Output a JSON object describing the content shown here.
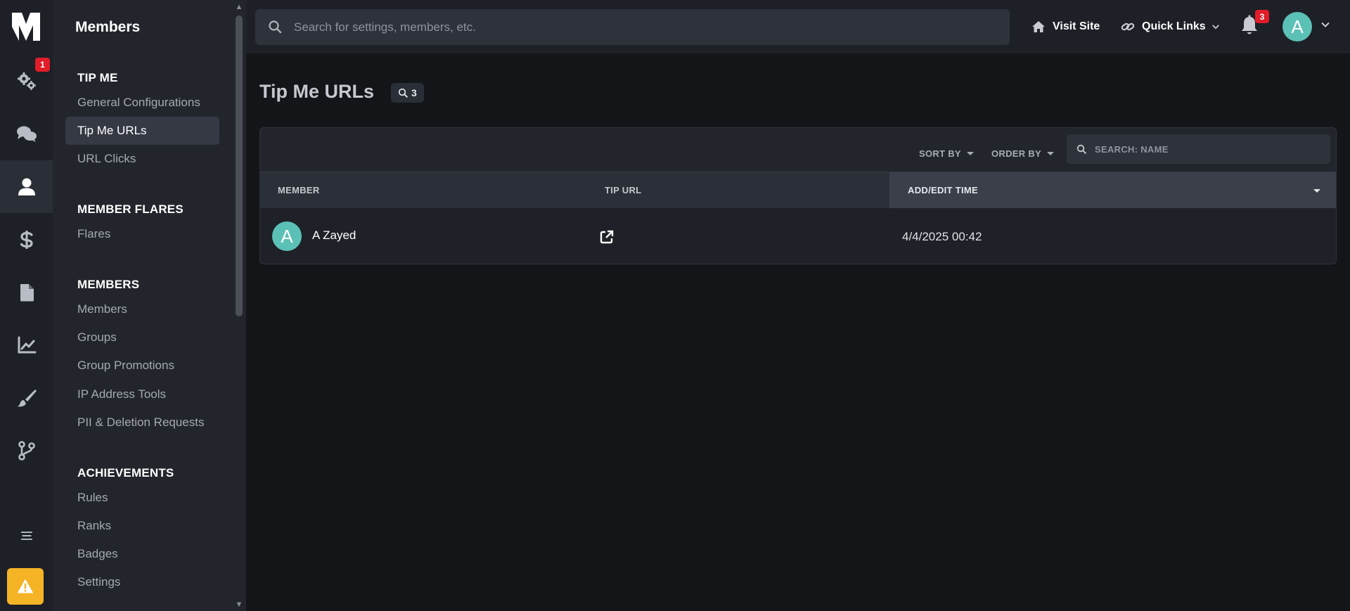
{
  "header": {
    "search_placeholder": "Search for settings, members, etc.",
    "visit_site": "Visit Site",
    "quick_links": "Quick Links",
    "notification_count": "3",
    "avatar_letter": "A"
  },
  "rail": {
    "settings_badge": "1",
    "items": [
      "gears-icon",
      "chat-icon",
      "user-icon",
      "dollar-icon",
      "file-icon",
      "chart-line-icon",
      "paintbrush-icon",
      "branch-icon",
      "menu-icon"
    ],
    "active": "user-icon"
  },
  "subnav": {
    "title": "Members",
    "sections": [
      {
        "label": "TIP ME",
        "links": [
          "General Configurations",
          "Tip Me URLs",
          "URL Clicks"
        ]
      },
      {
        "label": "MEMBER FLARES",
        "links": [
          "Flares"
        ]
      },
      {
        "label": "MEMBERS",
        "links": [
          "Members",
          "Groups",
          "Group Promotions",
          "IP Address Tools",
          "PII & Deletion Requests"
        ]
      },
      {
        "label": "ACHIEVEMENTS",
        "links": [
          "Rules",
          "Ranks",
          "Badges",
          "Settings"
        ]
      }
    ],
    "active_link": "Tip Me URLs"
  },
  "main": {
    "title": "Tip Me URLs",
    "count": "3",
    "toolbar": {
      "sort_by": "SORT BY",
      "order_by": "ORDER BY",
      "search_placeholder": "SEARCH: NAME"
    },
    "columns": [
      "MEMBER",
      "TIP URL",
      "ADD/EDIT TIME"
    ],
    "rows": [
      {
        "avatar_letter": "A",
        "member": "A Zayed",
        "time": "4/4/2025 00:42"
      }
    ]
  },
  "colors": {
    "accent_avatar": "#5bc0b6",
    "badge_red": "#e11d2a",
    "warning_yellow": "#f5b326"
  }
}
